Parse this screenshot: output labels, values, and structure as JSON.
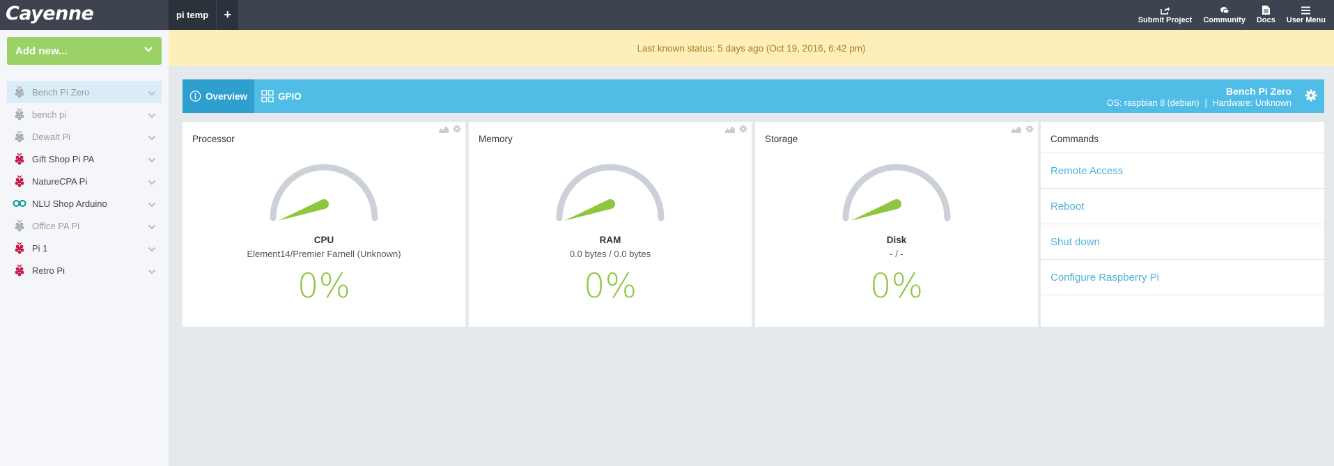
{
  "app": {
    "logo": "Cayenne"
  },
  "tabs": [
    {
      "label": "pi temp"
    },
    {
      "label": "+"
    }
  ],
  "topnav": [
    {
      "label": "Submit Project",
      "icon": "share-icon"
    },
    {
      "label": "Community",
      "icon": "chat-icon"
    },
    {
      "label": "Docs",
      "icon": "document-icon"
    },
    {
      "label": "User Menu",
      "icon": "menu-icon"
    }
  ],
  "sidebar": {
    "add_new_label": "Add new...",
    "devices": [
      {
        "label": "Bench Pi Zero",
        "icon": "raspberry-pi-icon",
        "status": "offline",
        "selected": true
      },
      {
        "label": "bench pi",
        "icon": "raspberry-pi-icon",
        "status": "offline"
      },
      {
        "label": "Dewalt Pi",
        "icon": "raspberry-pi-icon",
        "status": "offline"
      },
      {
        "label": "Gift Shop Pi PA",
        "icon": "raspberry-pi-icon",
        "status": "online"
      },
      {
        "label": "NatureCPA Pi",
        "icon": "raspberry-pi-icon",
        "status": "online"
      },
      {
        "label": "NLU Shop Arduino",
        "icon": "arduino-icon",
        "status": "online"
      },
      {
        "label": "Office PA Pi",
        "icon": "raspberry-pi-icon",
        "status": "offline"
      },
      {
        "label": "Pi 1",
        "icon": "raspberry-pi-icon",
        "status": "online"
      },
      {
        "label": "Retro Pi",
        "icon": "raspberry-pi-icon",
        "status": "online"
      }
    ]
  },
  "banner": {
    "text": "Last known status: 5 days ago (Oct 19, 2016, 6:42 pm)"
  },
  "device_header": {
    "tab_overview": "Overview",
    "tab_gpio": "GPIO",
    "name": "Bench Pi Zero",
    "os": "OS: raspbian 8 (debian)",
    "separator": "|",
    "hardware": "Hardware: Unknown"
  },
  "widgets": [
    {
      "title": "Processor",
      "label": "CPU",
      "sub": "Element14/Premier Farnell (Unknown)",
      "value": "0%",
      "level": 0
    },
    {
      "title": "Memory",
      "label": "RAM",
      "sub": "0.0 bytes / 0.0 bytes",
      "value": "0%",
      "level": 0
    },
    {
      "title": "Storage",
      "label": "Disk",
      "sub": "- / -",
      "value": "0%",
      "level": 0
    }
  ],
  "commands": {
    "title": "Commands",
    "items": [
      {
        "label": "Remote Access"
      },
      {
        "label": "Reboot"
      },
      {
        "label": "Shut down"
      },
      {
        "label": "Configure Raspberry Pi"
      }
    ]
  },
  "colors": {
    "accent_green": "#8ec63f",
    "header_blue": "#4fbde6",
    "link_blue": "#4fb2dc",
    "banner_bg": "#fdefb7",
    "pi_red": "#c51a4a",
    "arduino_teal": "#00979c"
  }
}
